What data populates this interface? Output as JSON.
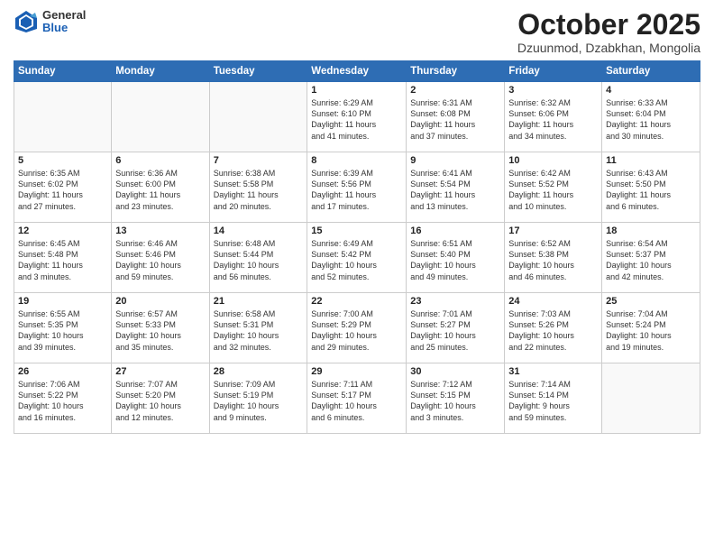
{
  "logo": {
    "general": "General",
    "blue": "Blue"
  },
  "title": "October 2025",
  "subtitle": "Dzuunmod, Dzabkhan, Mongolia",
  "days_header": [
    "Sunday",
    "Monday",
    "Tuesday",
    "Wednesday",
    "Thursday",
    "Friday",
    "Saturday"
  ],
  "weeks": [
    [
      {
        "day": "",
        "info": ""
      },
      {
        "day": "",
        "info": ""
      },
      {
        "day": "",
        "info": ""
      },
      {
        "day": "1",
        "info": "Sunrise: 6:29 AM\nSunset: 6:10 PM\nDaylight: 11 hours\nand 41 minutes."
      },
      {
        "day": "2",
        "info": "Sunrise: 6:31 AM\nSunset: 6:08 PM\nDaylight: 11 hours\nand 37 minutes."
      },
      {
        "day": "3",
        "info": "Sunrise: 6:32 AM\nSunset: 6:06 PM\nDaylight: 11 hours\nand 34 minutes."
      },
      {
        "day": "4",
        "info": "Sunrise: 6:33 AM\nSunset: 6:04 PM\nDaylight: 11 hours\nand 30 minutes."
      }
    ],
    [
      {
        "day": "5",
        "info": "Sunrise: 6:35 AM\nSunset: 6:02 PM\nDaylight: 11 hours\nand 27 minutes."
      },
      {
        "day": "6",
        "info": "Sunrise: 6:36 AM\nSunset: 6:00 PM\nDaylight: 11 hours\nand 23 minutes."
      },
      {
        "day": "7",
        "info": "Sunrise: 6:38 AM\nSunset: 5:58 PM\nDaylight: 11 hours\nand 20 minutes."
      },
      {
        "day": "8",
        "info": "Sunrise: 6:39 AM\nSunset: 5:56 PM\nDaylight: 11 hours\nand 17 minutes."
      },
      {
        "day": "9",
        "info": "Sunrise: 6:41 AM\nSunset: 5:54 PM\nDaylight: 11 hours\nand 13 minutes."
      },
      {
        "day": "10",
        "info": "Sunrise: 6:42 AM\nSunset: 5:52 PM\nDaylight: 11 hours\nand 10 minutes."
      },
      {
        "day": "11",
        "info": "Sunrise: 6:43 AM\nSunset: 5:50 PM\nDaylight: 11 hours\nand 6 minutes."
      }
    ],
    [
      {
        "day": "12",
        "info": "Sunrise: 6:45 AM\nSunset: 5:48 PM\nDaylight: 11 hours\nand 3 minutes."
      },
      {
        "day": "13",
        "info": "Sunrise: 6:46 AM\nSunset: 5:46 PM\nDaylight: 10 hours\nand 59 minutes."
      },
      {
        "day": "14",
        "info": "Sunrise: 6:48 AM\nSunset: 5:44 PM\nDaylight: 10 hours\nand 56 minutes."
      },
      {
        "day": "15",
        "info": "Sunrise: 6:49 AM\nSunset: 5:42 PM\nDaylight: 10 hours\nand 52 minutes."
      },
      {
        "day": "16",
        "info": "Sunrise: 6:51 AM\nSunset: 5:40 PM\nDaylight: 10 hours\nand 49 minutes."
      },
      {
        "day": "17",
        "info": "Sunrise: 6:52 AM\nSunset: 5:38 PM\nDaylight: 10 hours\nand 46 minutes."
      },
      {
        "day": "18",
        "info": "Sunrise: 6:54 AM\nSunset: 5:37 PM\nDaylight: 10 hours\nand 42 minutes."
      }
    ],
    [
      {
        "day": "19",
        "info": "Sunrise: 6:55 AM\nSunset: 5:35 PM\nDaylight: 10 hours\nand 39 minutes."
      },
      {
        "day": "20",
        "info": "Sunrise: 6:57 AM\nSunset: 5:33 PM\nDaylight: 10 hours\nand 35 minutes."
      },
      {
        "day": "21",
        "info": "Sunrise: 6:58 AM\nSunset: 5:31 PM\nDaylight: 10 hours\nand 32 minutes."
      },
      {
        "day": "22",
        "info": "Sunrise: 7:00 AM\nSunset: 5:29 PM\nDaylight: 10 hours\nand 29 minutes."
      },
      {
        "day": "23",
        "info": "Sunrise: 7:01 AM\nSunset: 5:27 PM\nDaylight: 10 hours\nand 25 minutes."
      },
      {
        "day": "24",
        "info": "Sunrise: 7:03 AM\nSunset: 5:26 PM\nDaylight: 10 hours\nand 22 minutes."
      },
      {
        "day": "25",
        "info": "Sunrise: 7:04 AM\nSunset: 5:24 PM\nDaylight: 10 hours\nand 19 minutes."
      }
    ],
    [
      {
        "day": "26",
        "info": "Sunrise: 7:06 AM\nSunset: 5:22 PM\nDaylight: 10 hours\nand 16 minutes."
      },
      {
        "day": "27",
        "info": "Sunrise: 7:07 AM\nSunset: 5:20 PM\nDaylight: 10 hours\nand 12 minutes."
      },
      {
        "day": "28",
        "info": "Sunrise: 7:09 AM\nSunset: 5:19 PM\nDaylight: 10 hours\nand 9 minutes."
      },
      {
        "day": "29",
        "info": "Sunrise: 7:11 AM\nSunset: 5:17 PM\nDaylight: 10 hours\nand 6 minutes."
      },
      {
        "day": "30",
        "info": "Sunrise: 7:12 AM\nSunset: 5:15 PM\nDaylight: 10 hours\nand 3 minutes."
      },
      {
        "day": "31",
        "info": "Sunrise: 7:14 AM\nSunset: 5:14 PM\nDaylight: 9 hours\nand 59 minutes."
      },
      {
        "day": "",
        "info": ""
      }
    ]
  ]
}
